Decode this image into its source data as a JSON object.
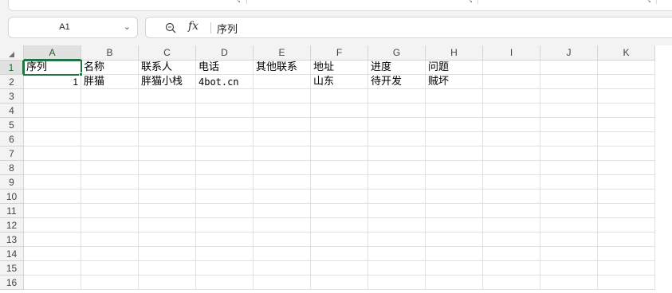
{
  "formula_bar": {
    "name_box": "A1",
    "fx_label": "fx",
    "content": "序列"
  },
  "columns": [
    "A",
    "B",
    "C",
    "D",
    "E",
    "F",
    "G",
    "H",
    "I",
    "J",
    "K"
  ],
  "rows": [
    "1",
    "2",
    "3",
    "4",
    "5",
    "6",
    "7",
    "8",
    "9",
    "10",
    "11",
    "12",
    "13",
    "14",
    "15",
    "16"
  ],
  "cells": {
    "A1": "序列",
    "B1": "名称",
    "C1": "联系人",
    "D1": "电话",
    "E1": "其他联系",
    "F1": "地址",
    "G1": "进度",
    "H1": "问题",
    "A2": "1",
    "B2": "胖猫",
    "C2": "胖猫小栈",
    "D2": "4bot.cn",
    "F2": "山东",
    "G2": "待开发",
    "H2": "贼坏"
  },
  "selection": {
    "active_cell": "A1",
    "accent_color": "#217346"
  },
  "icons": {
    "zoom": "zoom-formula-icon",
    "chevron": "chevron-down-icon",
    "select_all": "select-all-icon"
  }
}
